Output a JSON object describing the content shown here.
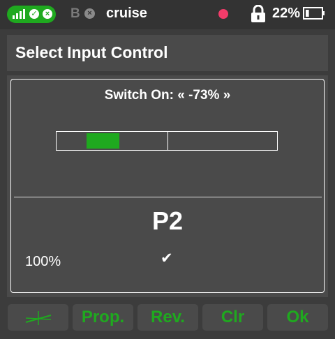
{
  "colors": {
    "accent": "#1fa91f",
    "panel": "#4a4a4a",
    "background": "#3c3c3c",
    "record": "#f23c6a"
  },
  "status": {
    "mode_letter": "B",
    "model_name": "cruise",
    "battery_percent": "22%",
    "battery_level": 0.22,
    "icons": [
      "signal-icon",
      "check-circle-icon",
      "close-circle-icon",
      "close-circle-icon",
      "record-dot-icon",
      "lock-icon",
      "battery-icon"
    ]
  },
  "title": "Select Input Control",
  "dialog": {
    "switch_label": "Switch On: « -73% »",
    "switch_value_percent": -73,
    "input_name": "P2",
    "weight": "100%",
    "check_icon": "check-icon"
  },
  "buttons": {
    "curve_icon": "curve-icon",
    "prop": "Prop.",
    "rev": "Rev.",
    "clr": "Clr",
    "ok": "Ok"
  }
}
